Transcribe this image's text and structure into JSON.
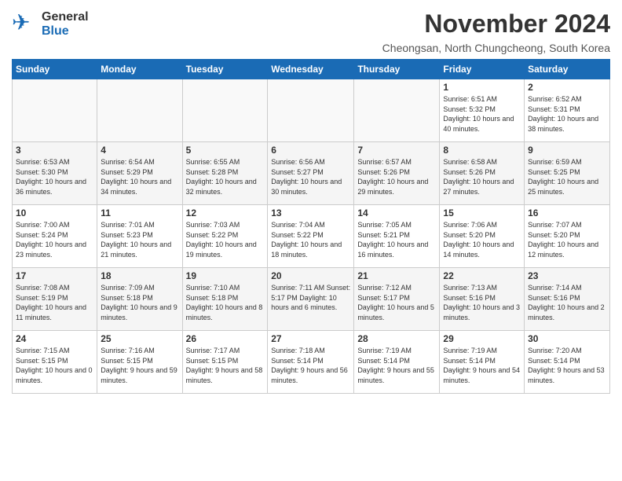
{
  "header": {
    "logo_general": "General",
    "logo_blue": "Blue",
    "month_title": "November 2024",
    "subtitle": "Cheongsan, North Chungcheong, South Korea"
  },
  "calendar": {
    "days_of_week": [
      "Sunday",
      "Monday",
      "Tuesday",
      "Wednesday",
      "Thursday",
      "Friday",
      "Saturday"
    ],
    "weeks": [
      [
        {
          "day": "",
          "info": ""
        },
        {
          "day": "",
          "info": ""
        },
        {
          "day": "",
          "info": ""
        },
        {
          "day": "",
          "info": ""
        },
        {
          "day": "",
          "info": ""
        },
        {
          "day": "1",
          "info": "Sunrise: 6:51 AM\nSunset: 5:32 PM\nDaylight: 10 hours\nand 40 minutes."
        },
        {
          "day": "2",
          "info": "Sunrise: 6:52 AM\nSunset: 5:31 PM\nDaylight: 10 hours\nand 38 minutes."
        }
      ],
      [
        {
          "day": "3",
          "info": "Sunrise: 6:53 AM\nSunset: 5:30 PM\nDaylight: 10 hours\nand 36 minutes."
        },
        {
          "day": "4",
          "info": "Sunrise: 6:54 AM\nSunset: 5:29 PM\nDaylight: 10 hours\nand 34 minutes."
        },
        {
          "day": "5",
          "info": "Sunrise: 6:55 AM\nSunset: 5:28 PM\nDaylight: 10 hours\nand 32 minutes."
        },
        {
          "day": "6",
          "info": "Sunrise: 6:56 AM\nSunset: 5:27 PM\nDaylight: 10 hours\nand 30 minutes."
        },
        {
          "day": "7",
          "info": "Sunrise: 6:57 AM\nSunset: 5:26 PM\nDaylight: 10 hours\nand 29 minutes."
        },
        {
          "day": "8",
          "info": "Sunrise: 6:58 AM\nSunset: 5:26 PM\nDaylight: 10 hours\nand 27 minutes."
        },
        {
          "day": "9",
          "info": "Sunrise: 6:59 AM\nSunset: 5:25 PM\nDaylight: 10 hours\nand 25 minutes."
        }
      ],
      [
        {
          "day": "10",
          "info": "Sunrise: 7:00 AM\nSunset: 5:24 PM\nDaylight: 10 hours\nand 23 minutes."
        },
        {
          "day": "11",
          "info": "Sunrise: 7:01 AM\nSunset: 5:23 PM\nDaylight: 10 hours\nand 21 minutes."
        },
        {
          "day": "12",
          "info": "Sunrise: 7:03 AM\nSunset: 5:22 PM\nDaylight: 10 hours\nand 19 minutes."
        },
        {
          "day": "13",
          "info": "Sunrise: 7:04 AM\nSunset: 5:22 PM\nDaylight: 10 hours\nand 18 minutes."
        },
        {
          "day": "14",
          "info": "Sunrise: 7:05 AM\nSunset: 5:21 PM\nDaylight: 10 hours\nand 16 minutes."
        },
        {
          "day": "15",
          "info": "Sunrise: 7:06 AM\nSunset: 5:20 PM\nDaylight: 10 hours\nand 14 minutes."
        },
        {
          "day": "16",
          "info": "Sunrise: 7:07 AM\nSunset: 5:20 PM\nDaylight: 10 hours\nand 12 minutes."
        }
      ],
      [
        {
          "day": "17",
          "info": "Sunrise: 7:08 AM\nSunset: 5:19 PM\nDaylight: 10 hours\nand 11 minutes."
        },
        {
          "day": "18",
          "info": "Sunrise: 7:09 AM\nSunset: 5:18 PM\nDaylight: 10 hours\nand 9 minutes."
        },
        {
          "day": "19",
          "info": "Sunrise: 7:10 AM\nSunset: 5:18 PM\nDaylight: 10 hours\nand 8 minutes."
        },
        {
          "day": "20",
          "info": "Sunrise: 7:11 AM\nSunset: 5:17 PM\nDaylight: 10 hours\nand 6 minutes."
        },
        {
          "day": "21",
          "info": "Sunrise: 7:12 AM\nSunset: 5:17 PM\nDaylight: 10 hours\nand 5 minutes."
        },
        {
          "day": "22",
          "info": "Sunrise: 7:13 AM\nSunset: 5:16 PM\nDaylight: 10 hours\nand 3 minutes."
        },
        {
          "day": "23",
          "info": "Sunrise: 7:14 AM\nSunset: 5:16 PM\nDaylight: 10 hours\nand 2 minutes."
        }
      ],
      [
        {
          "day": "24",
          "info": "Sunrise: 7:15 AM\nSunset: 5:15 PM\nDaylight: 10 hours\nand 0 minutes."
        },
        {
          "day": "25",
          "info": "Sunrise: 7:16 AM\nSunset: 5:15 PM\nDaylight: 9 hours\nand 59 minutes."
        },
        {
          "day": "26",
          "info": "Sunrise: 7:17 AM\nSunset: 5:15 PM\nDaylight: 9 hours\nand 58 minutes."
        },
        {
          "day": "27",
          "info": "Sunrise: 7:18 AM\nSunset: 5:14 PM\nDaylight: 9 hours\nand 56 minutes."
        },
        {
          "day": "28",
          "info": "Sunrise: 7:19 AM\nSunset: 5:14 PM\nDaylight: 9 hours\nand 55 minutes."
        },
        {
          "day": "29",
          "info": "Sunrise: 7:19 AM\nSunset: 5:14 PM\nDaylight: 9 hours\nand 54 minutes."
        },
        {
          "day": "30",
          "info": "Sunrise: 7:20 AM\nSunset: 5:14 PM\nDaylight: 9 hours\nand 53 minutes."
        }
      ]
    ]
  }
}
